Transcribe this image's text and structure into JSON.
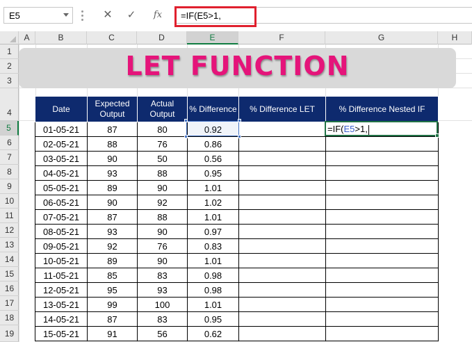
{
  "name_box": "E5",
  "formula_bar": {
    "cancel_icon": "✕",
    "enter_icon": "✓",
    "fx_label": "fx",
    "formula_prefix": "=IF(E5>1,"
  },
  "columns": [
    "A",
    "B",
    "C",
    "D",
    "E",
    "F",
    "G",
    "H"
  ],
  "rows": [
    "1",
    "2",
    "3",
    "4",
    "5",
    "6",
    "7",
    "8",
    "9",
    "10",
    "11",
    "12",
    "13",
    "14",
    "15",
    "16",
    "17",
    "18",
    "19"
  ],
  "banner_title": "LET FUNCTION",
  "table": {
    "headers": [
      "Date",
      "Expected Output",
      "Actual Output",
      "% Difference",
      "% Difference LET",
      "% Difference Nested IF"
    ],
    "rows": [
      [
        "01-05-21",
        "87",
        "80",
        "0.92",
        "",
        ""
      ],
      [
        "02-05-21",
        "88",
        "76",
        "0.86",
        "",
        ""
      ],
      [
        "03-05-21",
        "90",
        "50",
        "0.56",
        "",
        ""
      ],
      [
        "04-05-21",
        "93",
        "88",
        "0.95",
        "",
        ""
      ],
      [
        "05-05-21",
        "89",
        "90",
        "1.01",
        "",
        ""
      ],
      [
        "06-05-21",
        "90",
        "92",
        "1.02",
        "",
        ""
      ],
      [
        "07-05-21",
        "87",
        "88",
        "1.01",
        "",
        ""
      ],
      [
        "08-05-21",
        "93",
        "90",
        "0.97",
        "",
        ""
      ],
      [
        "09-05-21",
        "92",
        "76",
        "0.83",
        "",
        ""
      ],
      [
        "10-05-21",
        "89",
        "90",
        "1.01",
        "",
        ""
      ],
      [
        "11-05-21",
        "85",
        "83",
        "0.98",
        "",
        ""
      ],
      [
        "12-05-21",
        "95",
        "93",
        "0.98",
        "",
        ""
      ],
      [
        "13-05-21",
        "99",
        "100",
        "1.01",
        "",
        ""
      ],
      [
        "14-05-21",
        "87",
        "83",
        "0.95",
        "",
        ""
      ],
      [
        "15-05-21",
        "91",
        "56",
        "0.62",
        "",
        ""
      ]
    ],
    "editing_cell": {
      "before_ref": "=IF(",
      "ref": "E5",
      "after_ref": ">1,"
    }
  },
  "colors": {
    "header_fill": "#0e2a6e",
    "title_color": "#e5147a",
    "highlight_border": "#e0202e",
    "selection_green": "#217346"
  }
}
